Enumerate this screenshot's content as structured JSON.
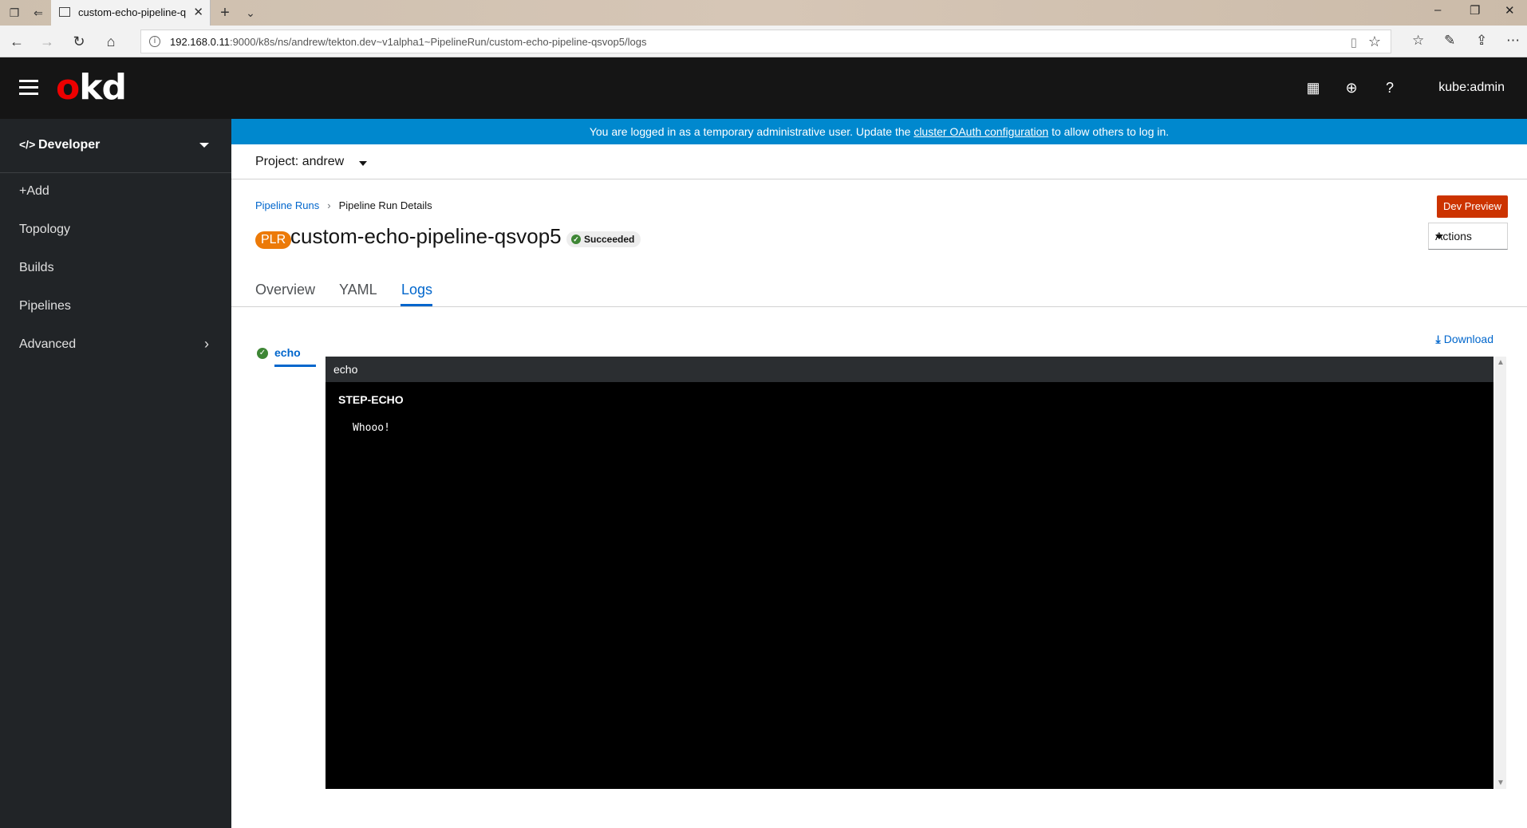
{
  "browser": {
    "tab_title": "custom-echo-pipeline-q",
    "url_host": "192.168.0.11",
    "url_rest": ":9000/k8s/ns/andrew/tekton.dev~v1alpha1~PipelineRun/custom-echo-pipeline-qsvop5/logs"
  },
  "masthead": {
    "logo_o": "o",
    "logo_kd": "kd",
    "user": "kube:admin"
  },
  "sidebar": {
    "perspective_code": "</>",
    "perspective": "Developer",
    "items": [
      {
        "label": "+Add"
      },
      {
        "label": "Topology"
      },
      {
        "label": "Builds"
      },
      {
        "label": "Pipelines"
      },
      {
        "label": "Advanced"
      }
    ]
  },
  "banner": {
    "pre": "You are logged in as a temporary administrative user. Update the ",
    "link": "cluster OAuth configuration",
    "post": " to allow others to log in."
  },
  "project": {
    "label": "Project: andrew"
  },
  "breadcrumb": {
    "parent": "Pipeline Runs",
    "current": "Pipeline Run Details"
  },
  "header": {
    "badge": "PLR",
    "name": "custom-echo-pipeline-qsvop5",
    "status": "Succeeded",
    "dev_preview": "Dev Preview",
    "actions": "Actions"
  },
  "tabs": [
    {
      "label": "Overview"
    },
    {
      "label": "YAML"
    },
    {
      "label": "Logs",
      "active": true
    }
  ],
  "logs": {
    "task": "echo",
    "download": "Download",
    "window_title": "echo",
    "step": "STEP-ECHO",
    "output": "Whooo!"
  },
  "colors": {
    "accent": "#0066cc",
    "banner": "#0088ce",
    "masthead": "#151515",
    "sidebar": "#212427",
    "success": "#3e8635",
    "plr_badge": "#ec7a08",
    "dev_preview": "#cc3300"
  }
}
